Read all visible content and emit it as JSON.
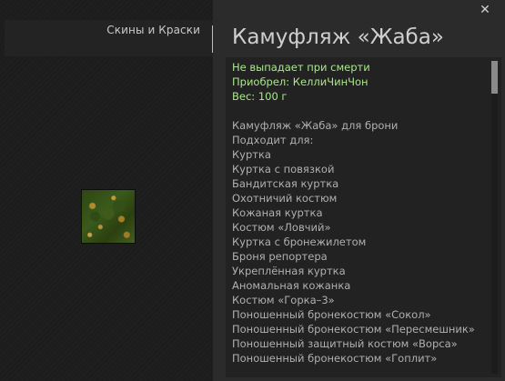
{
  "tab": {
    "label": "Скины и Краски"
  },
  "item": {
    "title": "Камуфляж «Жаба»",
    "icon": "camouflage-item-icon"
  },
  "close": {
    "glyph": "✕",
    "icon": "close-icon"
  },
  "info": {
    "no_drop": "Не выпадает при смерти",
    "acquired": "Приобрел: КеллиЧинЧон",
    "weight": "Вес: 100 г"
  },
  "description": {
    "line1": "Камуфляж «Жаба» для брони",
    "suitable_label": "Подходит для:",
    "armors": [
      "Куртка",
      "Куртка с повязкой",
      "Бандитская куртка",
      "Охотничий костюм",
      "Кожаная куртка",
      "Костюм «Ловчий»",
      "Куртка с бронежилетом",
      "Броня репортера",
      "Укреплённая куртка",
      "Аномальная кожанка",
      "Костюм «Горка–3»",
      "Поношенный бронекостюм «Сокол»",
      "Поношенный бронекостюм «Пересмешник»",
      "Поношенный защитный костюм «Ворса»",
      "Поношенный бронекостюм «Гоплит»"
    ]
  },
  "colors": {
    "accent_green": "#a9e78c",
    "text_gray": "#b0b0b0",
    "panel_bg": "#2b2b2b",
    "desc_bg": "#222222"
  }
}
